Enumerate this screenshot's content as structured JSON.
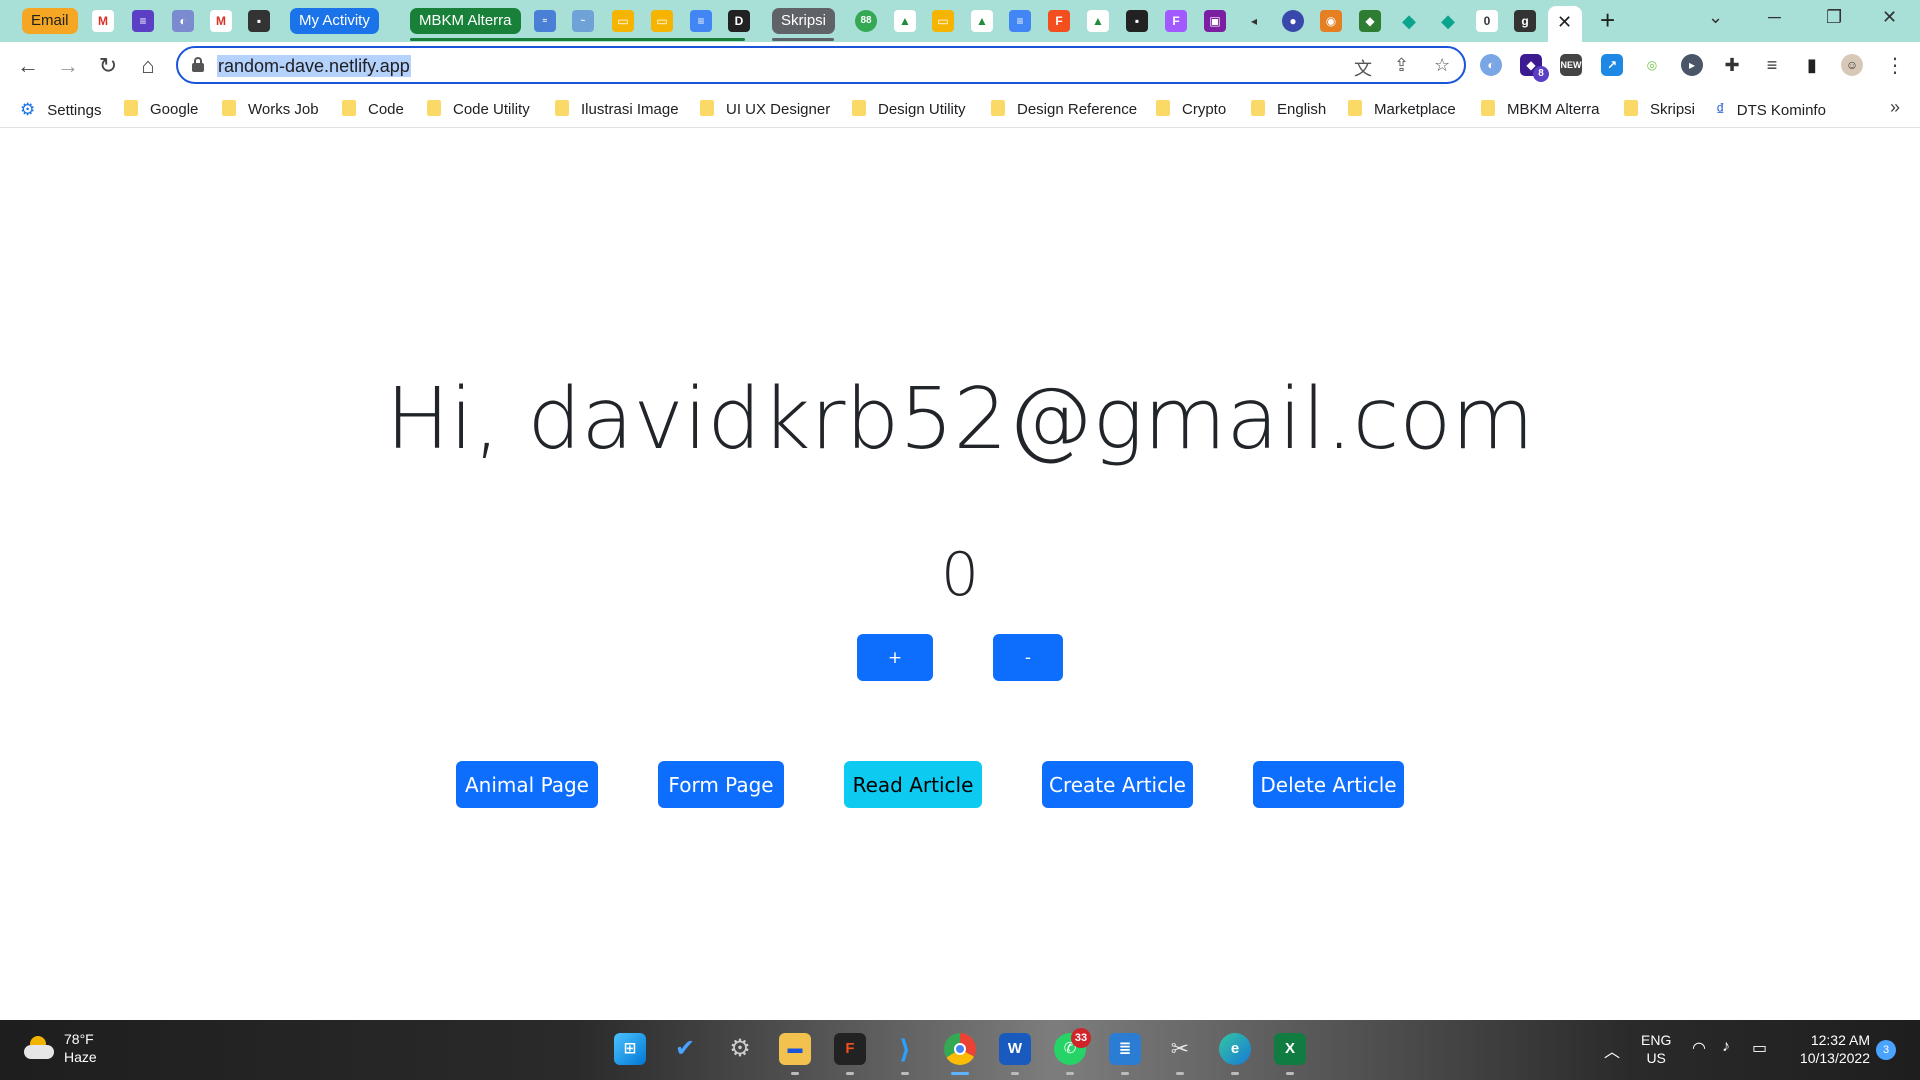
{
  "browser": {
    "tab_groups": {
      "email": "Email",
      "my_activity": "My Activity",
      "mbkm": "MBKM Alterra",
      "skripsi": "Skripsi"
    },
    "url": "random-dave.netlify.app"
  },
  "bookmarks": [
    "Settings",
    "Google",
    "Works Job",
    "Code",
    "Code Utility",
    "Ilustrasi Image",
    "UI UX Designer",
    "Design Utility",
    "Design Reference",
    "Crypto",
    "English",
    "Marketplace",
    "MBKM Alterra",
    "Skripsi",
    "DTS Kominfo"
  ],
  "page": {
    "greeting": "Hi, davidkrb52@gmail.com",
    "counter": "0",
    "increment_label": "+",
    "decrement_label": "-",
    "nav_buttons": [
      "Animal Page",
      "Form Page",
      "Read Article",
      "Create Article",
      "Delete Article"
    ]
  },
  "taskbar": {
    "weather_temp": "78°F",
    "weather_desc": "Haze",
    "whatsapp_badge": "33",
    "lang_top": "ENG",
    "lang_bottom": "US",
    "time": "12:32 AM",
    "date": "10/13/2022",
    "notifications": "3"
  },
  "extensions": {
    "badge": "8"
  },
  "colors": {
    "tabstrip_bg": "#a8dfd6",
    "primary_button": "#0d6efd",
    "info_button": "#0dcaf0",
    "omnibox_border": "#1a55d9",
    "url_highlight": "#b4d2fc"
  }
}
